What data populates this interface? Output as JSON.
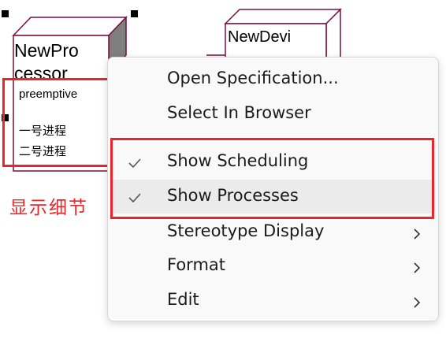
{
  "diagram": {
    "processor_node": {
      "name_line1": "NewPro",
      "name_line2": "cessor",
      "scheduling": "preemptive",
      "processes": [
        "一号进程",
        "二号进程"
      ]
    },
    "device_node": {
      "name": "NewDevi"
    }
  },
  "annotation": {
    "label": "显示细节"
  },
  "context_menu": {
    "items": [
      {
        "label": "Open Specification...",
        "checked": false,
        "submenu": false
      },
      {
        "label": "Select In Browser",
        "checked": false,
        "submenu": false
      },
      {
        "label": "Show Scheduling",
        "checked": true,
        "submenu": false
      },
      {
        "label": "Show Processes",
        "checked": true,
        "submenu": false
      },
      {
        "label": "Stereotype Display",
        "checked": false,
        "submenu": true
      },
      {
        "label": "Format",
        "checked": false,
        "submenu": true
      },
      {
        "label": "Edit",
        "checked": false,
        "submenu": true
      }
    ]
  },
  "colors": {
    "node_border": "#7a0f3a",
    "node_side": "#7f7f7f",
    "annotation": "#e8262b",
    "menu_bg": "#f9f9f9",
    "menu_hover": "#ebebeb"
  }
}
